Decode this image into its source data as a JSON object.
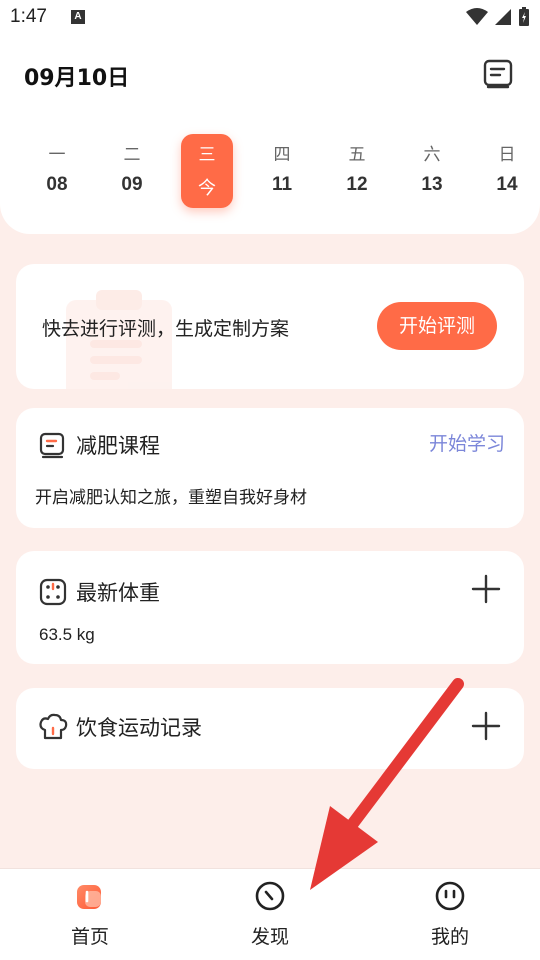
{
  "status_bar": {
    "time": "1:47",
    "notification_icon": "A"
  },
  "header": {
    "date_title": "09月10日",
    "calendar_icon": "calendar-list-icon"
  },
  "week": [
    {
      "weekday": "一",
      "day": "08",
      "active": false
    },
    {
      "weekday": "二",
      "day": "09",
      "active": false
    },
    {
      "weekday": "三",
      "day": "今",
      "active": true
    },
    {
      "weekday": "四",
      "day": "11",
      "active": false
    },
    {
      "weekday": "五",
      "day": "12",
      "active": false
    },
    {
      "weekday": "六",
      "day": "13",
      "active": false
    },
    {
      "weekday": "日",
      "day": "14",
      "active": false
    }
  ],
  "evaluation": {
    "text": "快去进行评测，生成定制方案",
    "button": "开始评测"
  },
  "course": {
    "title": "减肥课程",
    "link": "开始学习",
    "subtitle": "开启减肥认知之旅，重塑自我好身材"
  },
  "weight": {
    "title": "最新体重",
    "value": "63.5 kg"
  },
  "diet": {
    "title": "饮食运动记录"
  },
  "bottom_nav": {
    "home": "首页",
    "discover": "发现",
    "mine": "我的"
  },
  "colors": {
    "accent": "#ff6b47",
    "link": "#7b86d9",
    "background": "#fdeeea",
    "annotation_arrow": "#e53935"
  }
}
